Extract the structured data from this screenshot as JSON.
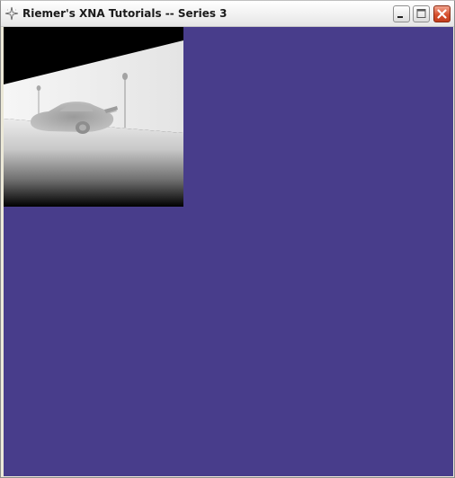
{
  "window": {
    "title": "Riemer's XNA Tutorials -- Series 3",
    "icon": "sparkle-icon",
    "controls": [
      "minimize-icon",
      "maximize-icon",
      "close-icon"
    ]
  },
  "client": {
    "background_color": "#483d8b",
    "render_target": {
      "description_icon": "depth-map-preview",
      "colors": {
        "sky": "#000000",
        "wall": "#e8e8e8",
        "floor_near": "#000000"
      }
    }
  }
}
